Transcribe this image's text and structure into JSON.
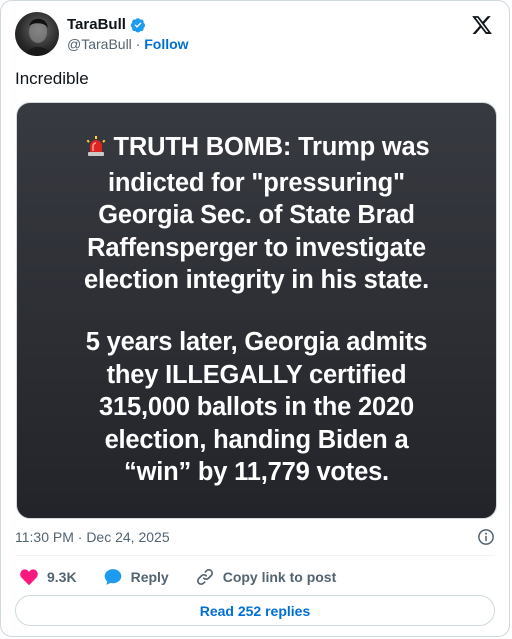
{
  "author": {
    "display_name": "TaraBull",
    "handle": "@TaraBull",
    "separator": "·",
    "follow_label": "Follow",
    "verified": true,
    "verified_color": "#1d9bf0"
  },
  "tweet": {
    "text": "Incredible"
  },
  "media": {
    "paragraph1_lines": [
      "TRUTH BOMB: Trump was",
      "indicted for \"pressuring\"",
      "Georgia Sec. of State Brad",
      "Raffensperger to investigate",
      "election integrity in his state."
    ],
    "paragraph2_lines": [
      "5 years later, Georgia admits",
      "they ILLEGALLY certified",
      "315,000 ballots in the 2020",
      "election, handing Biden a",
      "“win” by 11,779 votes."
    ],
    "leading_icon": "police-siren-icon"
  },
  "meta": {
    "timestamp": "11:30 PM · Dec 24, 2025"
  },
  "actions": {
    "like_count": "9.3K",
    "reply_label": "Reply",
    "copy_link_label": "Copy link to post"
  },
  "footer": {
    "read_replies_label": "Read 252 replies"
  },
  "colors": {
    "accent": "#006fd6",
    "like_red": "#f91880",
    "reply_blue": "#1d9bf0",
    "muted": "#536471"
  }
}
